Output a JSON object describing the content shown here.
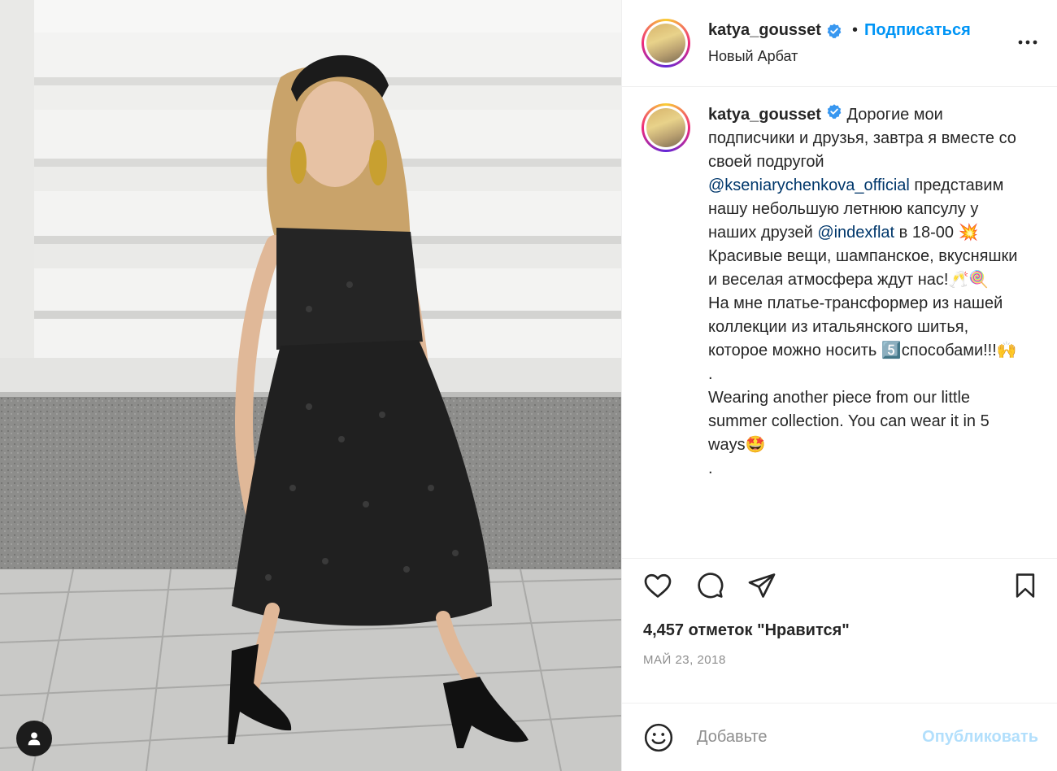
{
  "post": {
    "username": "katya_gousset",
    "verified": true,
    "follow_separator": "•",
    "follow_label": "Подписаться",
    "location": "Новый Арбат"
  },
  "caption": {
    "lines": [
      {
        "text": " Дорогие мои подписчики и друзья, завтра я вместе со своей подругой "
      },
      {
        "mention": "@kseniarychenkova_official"
      },
      {
        "text": " представим нашу небольшую летнюю капсулу у наших друзей "
      },
      {
        "mention": "@indexflat"
      },
      {
        "text": " в 18-00 💥\nКрасивые вещи, шампанское, вкусняшки и веселая атмосфера ждут нас!🥂🍭\nНа мне платье-трансформер из нашей коллекции из итальянского шитья, которое можно носить 5️⃣способами!!!🙌\n.\nWearing another piece from our little summer collection. You can wear it in 5 ways🤩\n."
      }
    ]
  },
  "actions": {
    "like_icon": "heart-icon",
    "comment_icon": "comment-icon",
    "share_icon": "paper-plane-icon",
    "save_icon": "bookmark-icon"
  },
  "likes_text": "4,457 отметок \"Нравится\"",
  "date_text": "МАЙ 23, 2018",
  "comment": {
    "placeholder": "Добавьте",
    "publish_label": "Опубликовать"
  },
  "colors": {
    "accent": "#0095f6",
    "mention": "#00376b",
    "publish_disabled": "#b2dffc",
    "muted": "#8e8e8e",
    "verified": "#3897f0"
  }
}
